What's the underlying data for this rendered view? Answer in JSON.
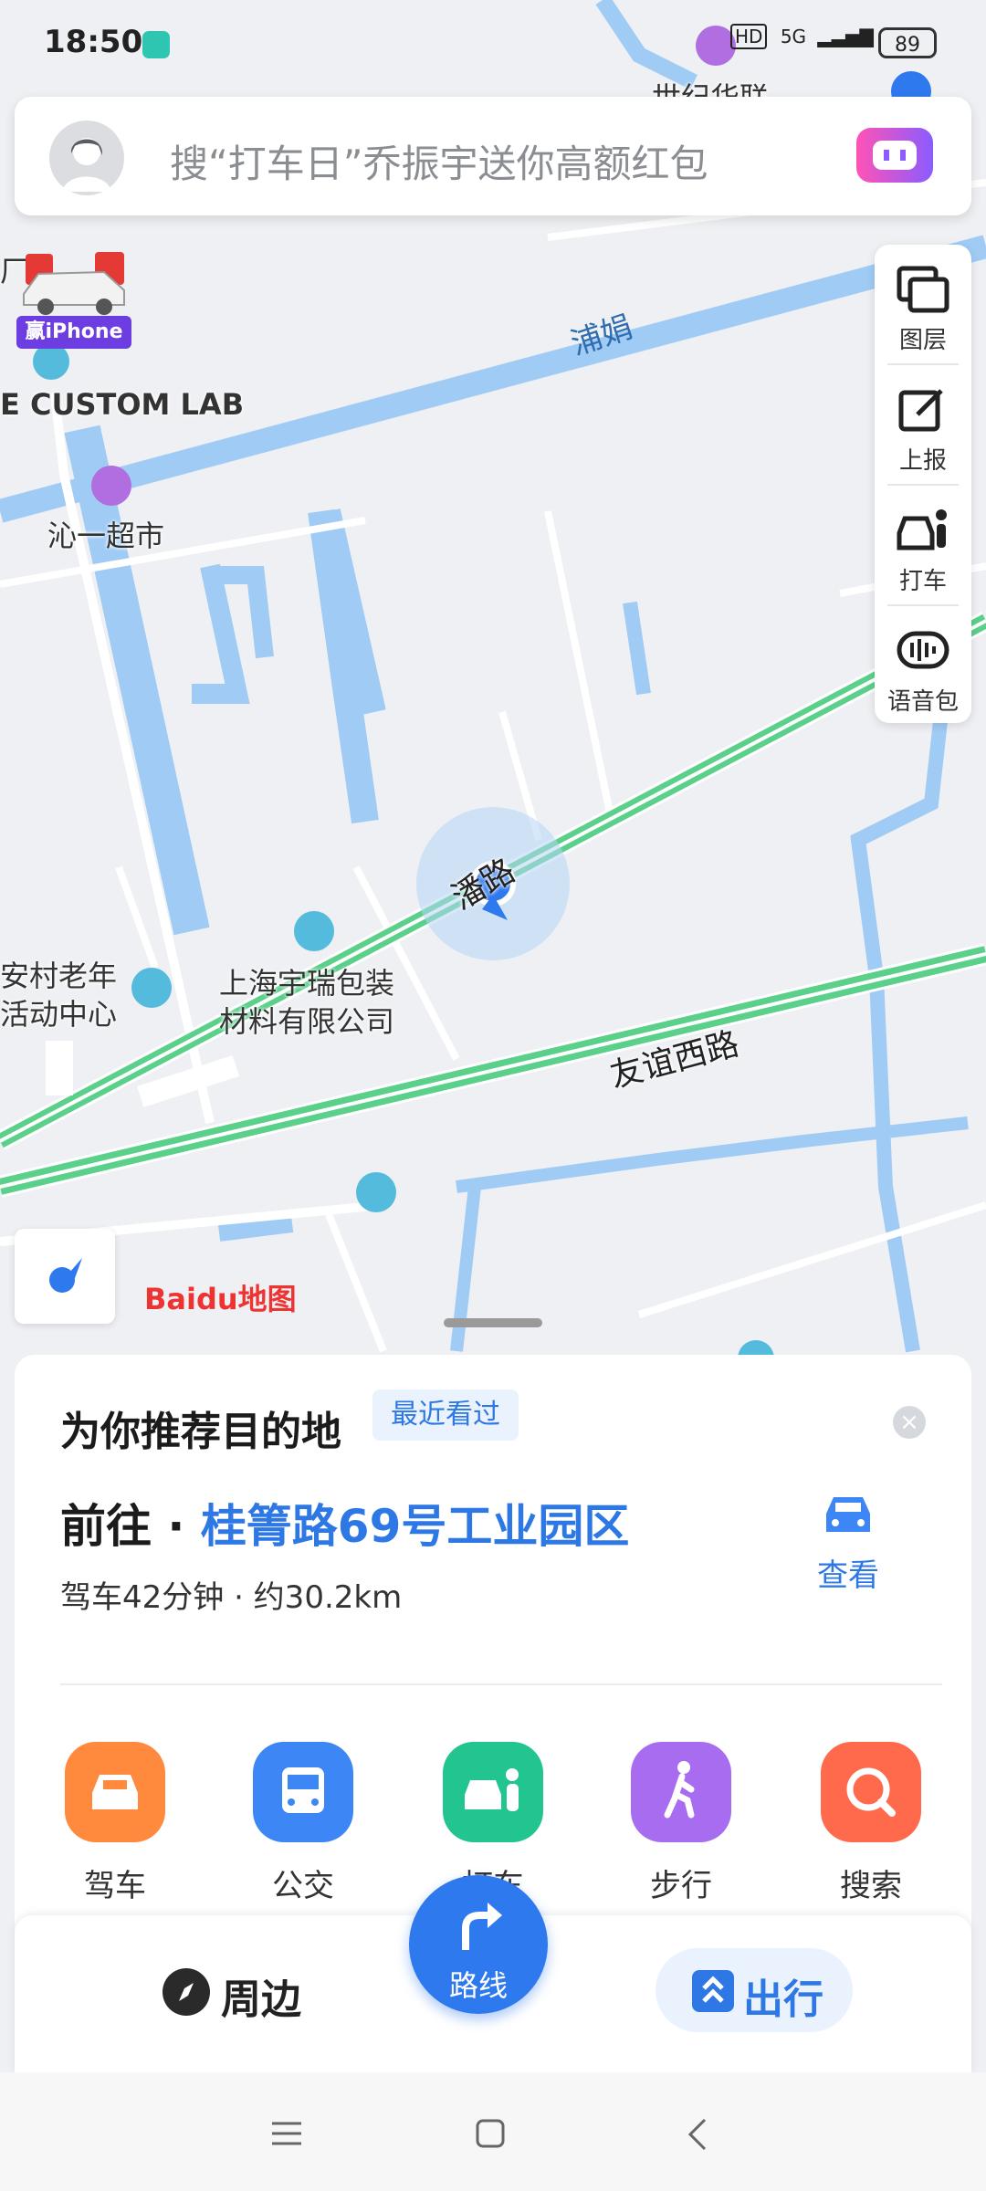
{
  "status_bar": {
    "time": "18:50",
    "battery": "89",
    "network": "5G",
    "hd": "HD"
  },
  "search": {
    "placeholder": "搜“打车日”乔振宇送你高额红包"
  },
  "promo": {
    "label": "赢iPhone"
  },
  "tools": [
    {
      "label": "图层",
      "icon": "layers-icon"
    },
    {
      "label": "上报",
      "icon": "report-icon"
    },
    {
      "label": "打车",
      "icon": "taxi-icon"
    },
    {
      "label": "语音包",
      "icon": "voice-pack-icon"
    }
  ],
  "map_labels": {
    "top_partial": "世纪华联",
    "lab": "E CUSTOM LAB",
    "lab_partial": "厂",
    "supermarket": "沁一超市",
    "road_pujuan": "浦娟",
    "road_near": "潘路",
    "road_youyi": "友谊西路",
    "company_line1": "上海宇瑞包装",
    "company_line2": "材料有限公司",
    "village_line1": "安村老年",
    "village_line2": "活动中心"
  },
  "baidu_logo": "Baidu地图",
  "recommend": {
    "title": "为你推荐目的地",
    "recent_tag": "最近看过",
    "dest_prefix": "前往 · ",
    "dest_name": "桂箐路69号工业园区",
    "dest_info": "驾车42分钟 · 约30.2km",
    "view_label": "查看"
  },
  "modes": [
    {
      "label": "驾车",
      "color": "#ff8a3d"
    },
    {
      "label": "公交",
      "color": "#3d86f5"
    },
    {
      "label": "打车",
      "color": "#22c48f"
    },
    {
      "label": "步行",
      "color": "#a86cf0"
    },
    {
      "label": "搜索",
      "color": "#ff6a4d"
    }
  ],
  "bottom_nav": {
    "nearby": "周边",
    "route": "路线",
    "trip": "出行"
  }
}
